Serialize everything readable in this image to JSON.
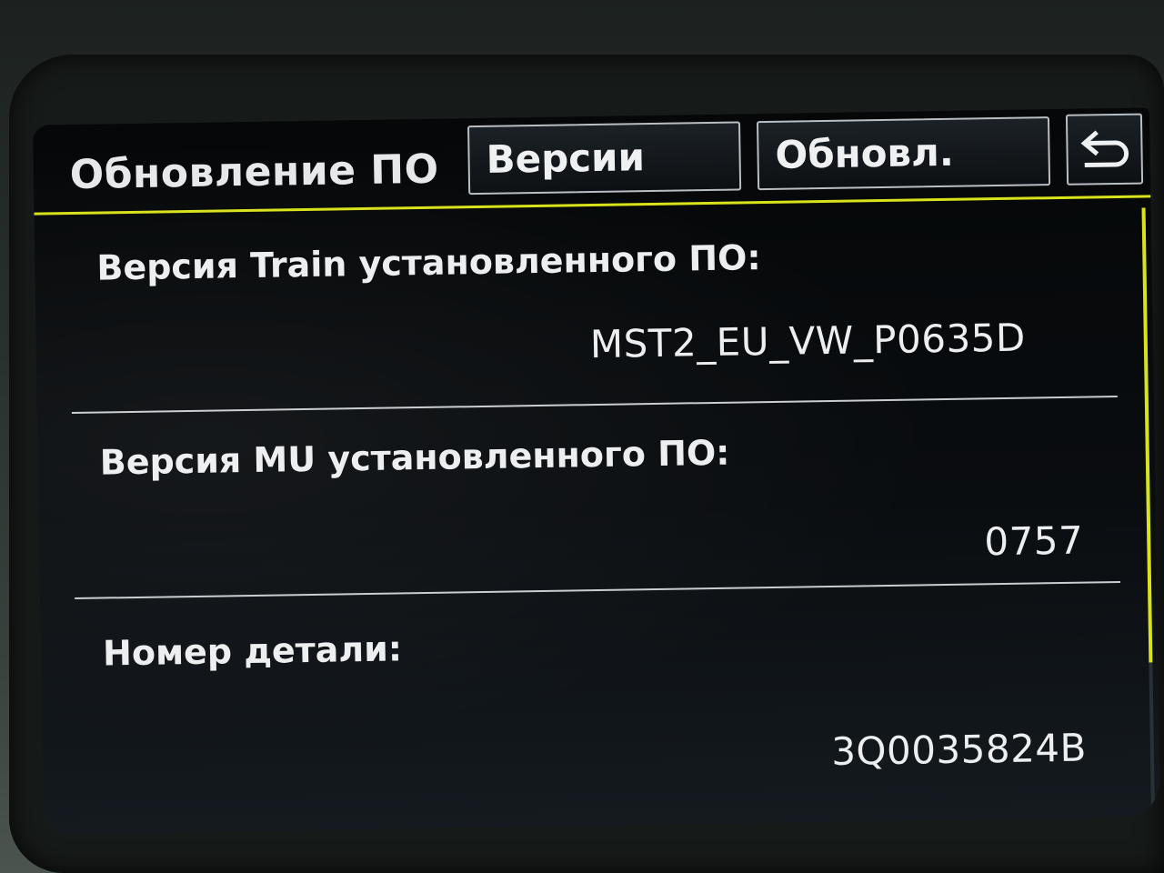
{
  "header": {
    "title": "Обновление ПО",
    "tabs": [
      {
        "label": "Версии"
      },
      {
        "label": "Обновл."
      }
    ],
    "back_icon": "back-arrow-icon"
  },
  "rows": [
    {
      "label": "Версия Train установленного ПО:",
      "value": "MST2_EU_VW_P0635D"
    },
    {
      "label": "Версия MU установленного ПО:",
      "value": "0757"
    },
    {
      "label": "Номер детали:",
      "value": "3Q0035824B"
    }
  ],
  "colors": {
    "accent": "#d8e31a",
    "text": "#eceeef",
    "background": "#0a0d10"
  }
}
